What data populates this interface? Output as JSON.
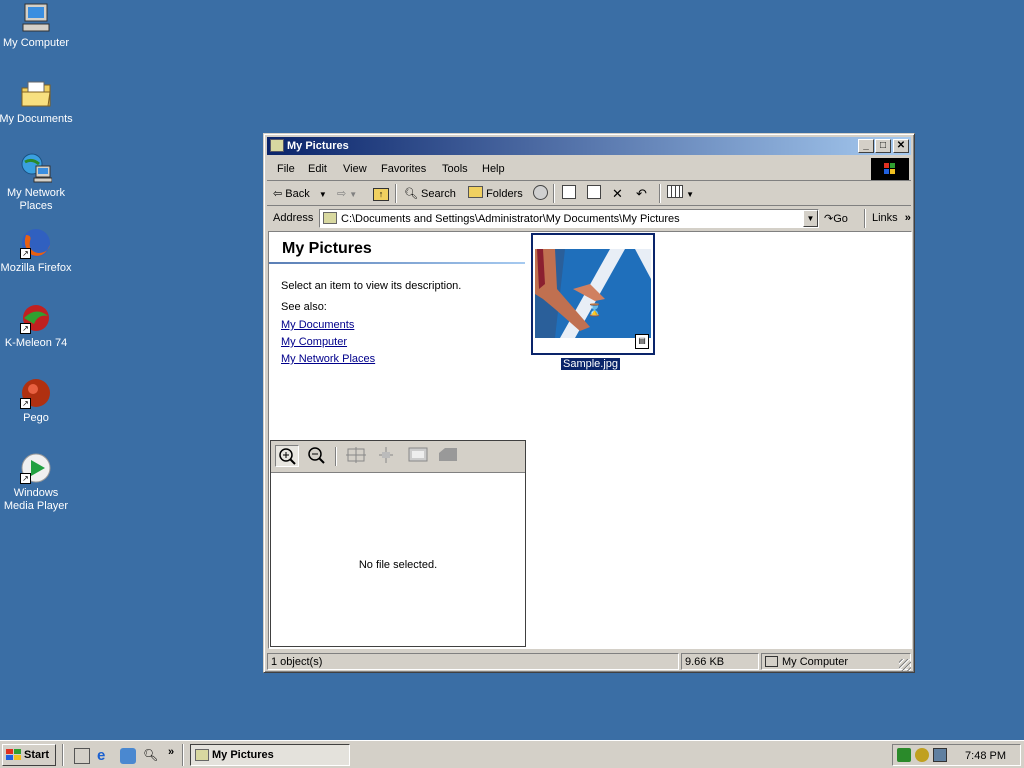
{
  "desktop": {
    "icons": [
      {
        "label": "My Computer"
      },
      {
        "label": "My Documents"
      },
      {
        "label": "My Network Places"
      },
      {
        "label": "Mozilla Firefox"
      },
      {
        "label": "K-Meleon 74"
      },
      {
        "label": "Pego"
      },
      {
        "label": "Windows Media Player"
      }
    ]
  },
  "window": {
    "title": "My Pictures",
    "menu": [
      "File",
      "Edit",
      "View",
      "Favorites",
      "Tools",
      "Help"
    ],
    "toolbar": {
      "back": "Back",
      "search": "Search",
      "folders": "Folders"
    },
    "address": {
      "label": "Address",
      "value": "C:\\Documents and Settings\\Administrator\\My Documents\\My Pictures",
      "go": "Go",
      "links": "Links"
    },
    "left_pane": {
      "heading": "My Pictures",
      "description": "Select an item to view its description.",
      "see_also": "See also:",
      "links": [
        "My Documents",
        "My Computer",
        "My Network Places"
      ],
      "preview_empty": "No file selected."
    },
    "files": [
      {
        "name": "Sample.jpg"
      }
    ],
    "status": {
      "objects": "1 object(s)",
      "size": "9.66 KB",
      "zone": "My Computer"
    }
  },
  "taskbar": {
    "start": "Start",
    "task": "My Pictures",
    "time": "7:48 PM"
  },
  "colors": {
    "desktop": "#3a6ea5",
    "title_active": "#0a246a",
    "face": "#d4d0c8",
    "link": "#00008b"
  }
}
